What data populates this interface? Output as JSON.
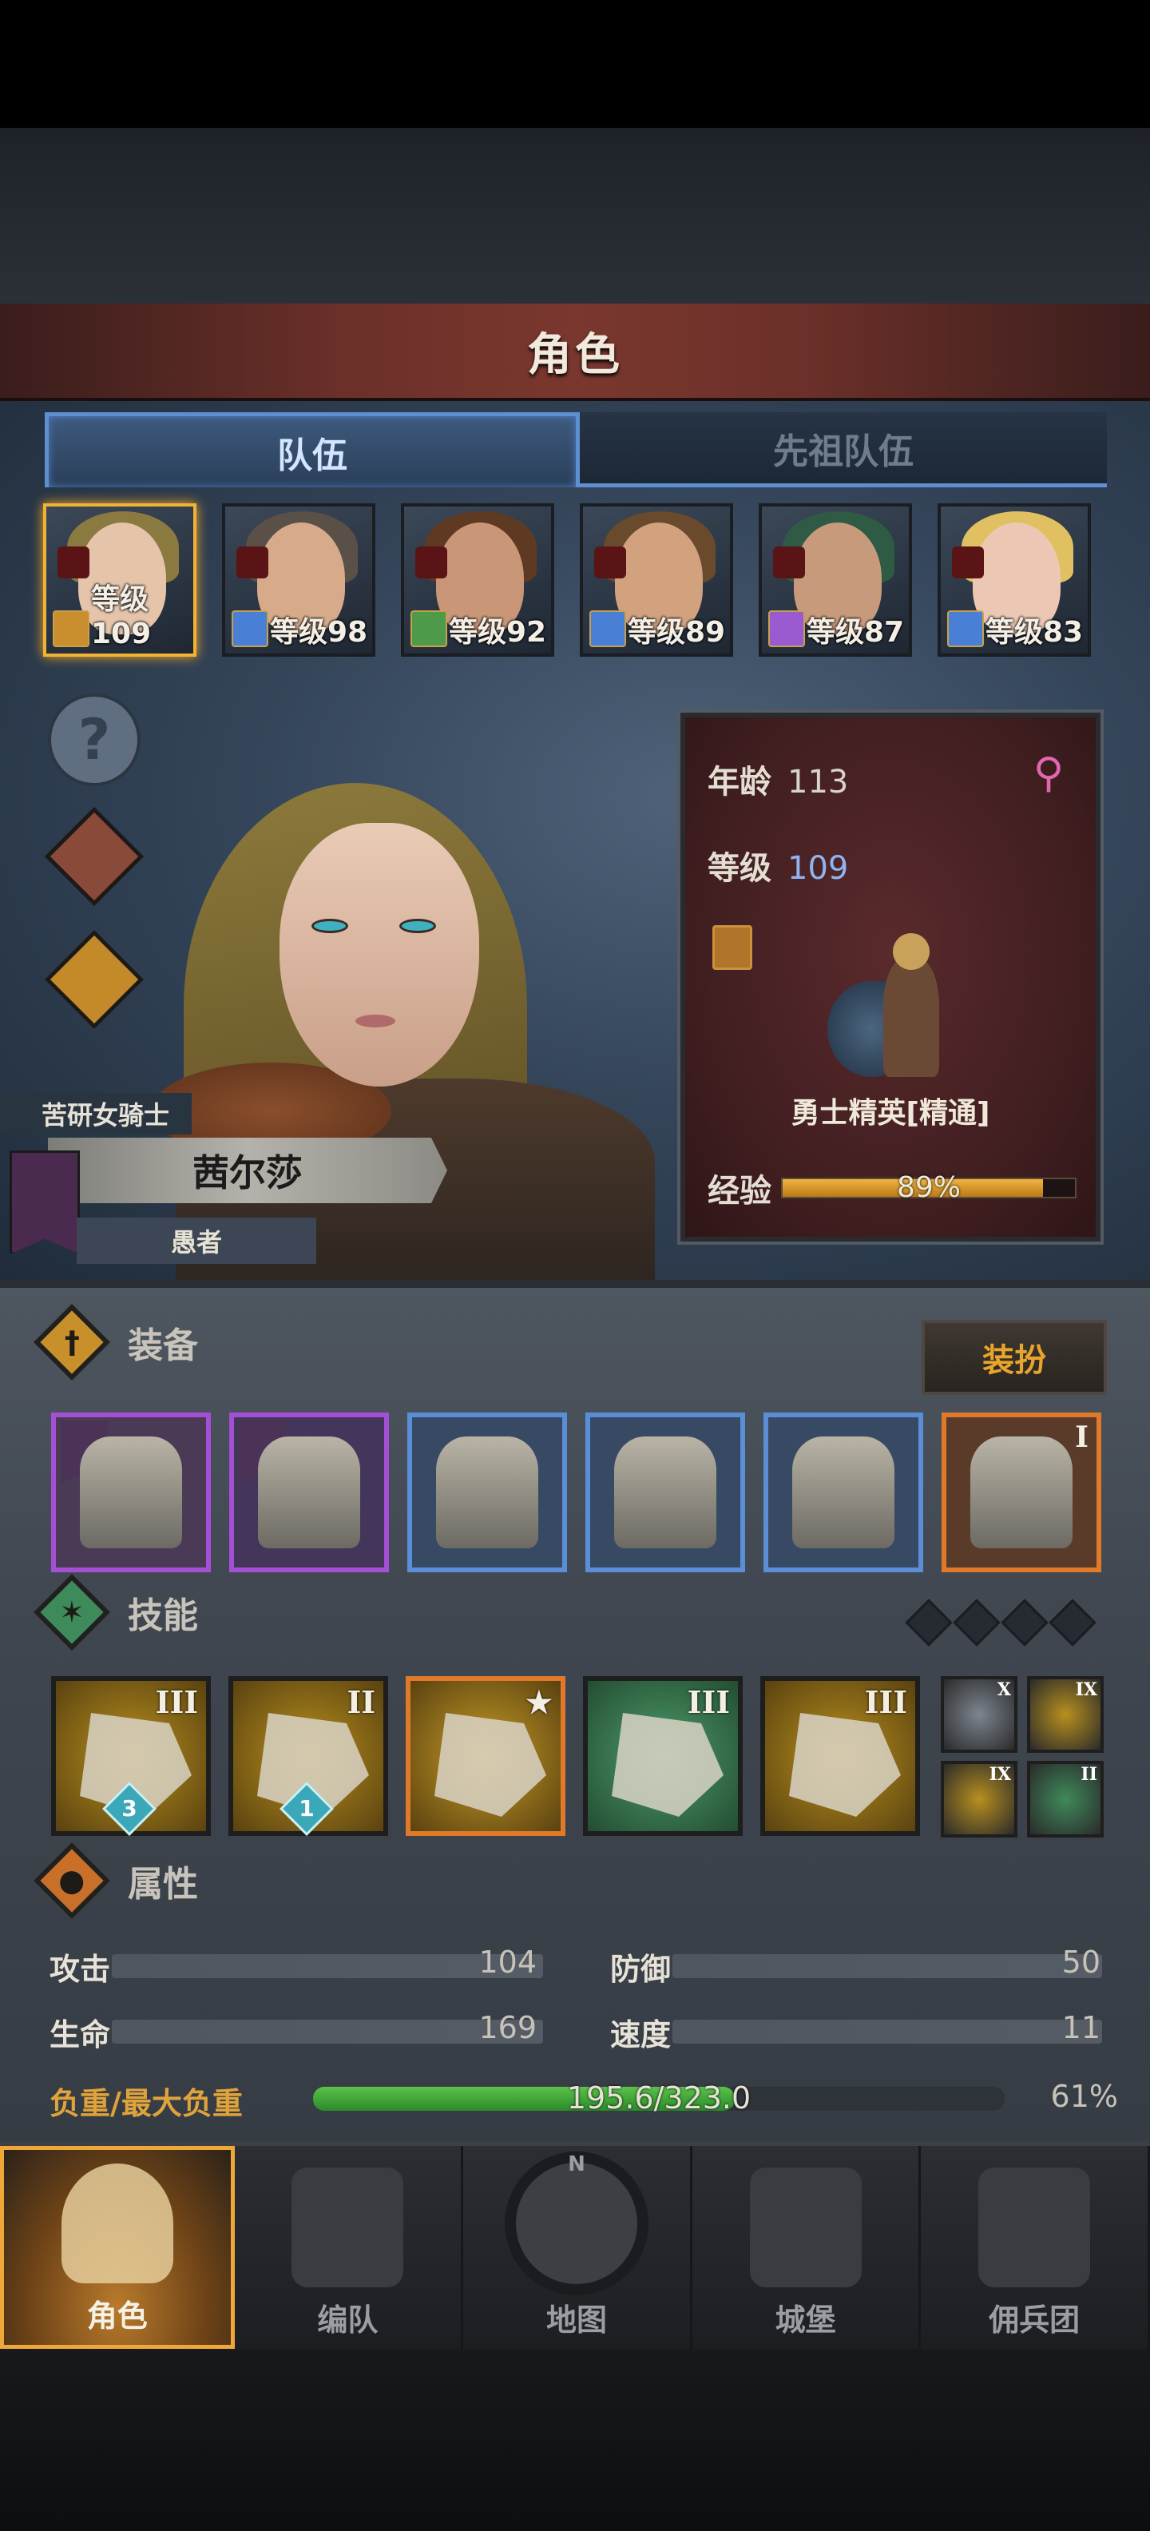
{
  "screen_title": "角色",
  "tabs": [
    {
      "label": "队伍",
      "active": true
    },
    {
      "label": "先祖队伍",
      "active": false
    }
  ],
  "heroes": [
    {
      "level": "等级109",
      "selected": true,
      "hair": "#8a7a40",
      "skin": "#e5c4aa",
      "badge_color": "#c98e2e"
    },
    {
      "level": "等级98",
      "selected": false,
      "hair": "#5a5048",
      "skin": "#d7aa8a",
      "badge_color": "#4a7fd6"
    },
    {
      "level": "等级92",
      "selected": false,
      "hair": "#5e3a22",
      "skin": "#c99778",
      "badge_color": "#4e9a48"
    },
    {
      "level": "等级89",
      "selected": false,
      "hair": "#6a4a2c",
      "skin": "#d2a27f",
      "badge_color": "#4a7fd6"
    },
    {
      "level": "等级87",
      "selected": false,
      "hair": "#2f5a44",
      "skin": "#c89a7c",
      "badge_color": "#9a5ad0"
    },
    {
      "level": "等级83",
      "selected": false,
      "hair": "#e0c060",
      "skin": "#ecc8b4",
      "badge_color": "#4a7fd6"
    }
  ],
  "character": {
    "class_title": "苦研女骑士",
    "name": "茜尔莎",
    "trait": "愚者",
    "age_label": "年龄",
    "age": "113",
    "gender_symbol": "⚲",
    "level_label": "等级",
    "level": "109",
    "class_name": "勇士精英[精通]",
    "exp_label": "经验",
    "exp_percent_text": "89%",
    "exp_fraction": 0.89
  },
  "equipment": {
    "title": "装备",
    "dress_button": "装扮",
    "slots": [
      {
        "name": "hammer",
        "frame": "#a44fd6",
        "bg": "#4b3a55"
      },
      {
        "name": "fan-shield",
        "frame": "#a44fd6",
        "bg": "#44365a"
      },
      {
        "name": "helmet",
        "frame": "#5a8fd8",
        "bg": "#384a63"
      },
      {
        "name": "armor",
        "frame": "#5a8fd8",
        "bg": "#384a63"
      },
      {
        "name": "boots",
        "frame": "#5a8fd8",
        "bg": "#384a63"
      },
      {
        "name": "amulet",
        "frame": "#e07a2a",
        "bg": "#5a3b2a",
        "rank": "I"
      }
    ]
  },
  "skills": {
    "title": "技能",
    "main": [
      {
        "rank": "III",
        "gem": "3",
        "bg": "#b8901e",
        "frame": "#1e1e1e"
      },
      {
        "rank": "II",
        "gem": "1",
        "bg": "#b8901e",
        "frame": "#1e1e1e"
      },
      {
        "rank": "★",
        "gem": "",
        "bg": "#c69a26",
        "frame": "#e07a2a"
      },
      {
        "rank": "III",
        "gem": "",
        "bg": "#3f8a5a",
        "frame": "#1e1e1e"
      },
      {
        "rank": "III",
        "gem": "",
        "bg": "#b8901e",
        "frame": "#1e1e1e"
      }
    ],
    "mini": [
      {
        "rank": "X",
        "bg": "#7d8590"
      },
      {
        "rank": "IX",
        "bg": "#b8901e"
      },
      {
        "rank": "IX",
        "bg": "#b8901e"
      },
      {
        "rank": "II",
        "bg": "#3f8a5a"
      }
    ]
  },
  "attributes": {
    "title": "属性",
    "attack_label": "攻击",
    "attack": "104",
    "defense_label": "防御",
    "defense": "50",
    "hp_label": "生命",
    "hp": "169",
    "speed_label": "速度",
    "speed": "11",
    "load_label": "负重/最大负重",
    "load_text": "195.6/323.0",
    "load_percent": "61%",
    "load_fraction": 0.61
  },
  "nav": [
    {
      "label": "角色",
      "active": true
    },
    {
      "label": "编队",
      "active": false
    },
    {
      "label": "地图",
      "active": false,
      "compass_n": "N"
    },
    {
      "label": "城堡",
      "active": false
    },
    {
      "label": "佣兵团",
      "active": false
    }
  ],
  "colors": {
    "accent_gold": "#f2b233",
    "tab_blue": "#5e8fd0",
    "load_label": "#e0a33b"
  }
}
